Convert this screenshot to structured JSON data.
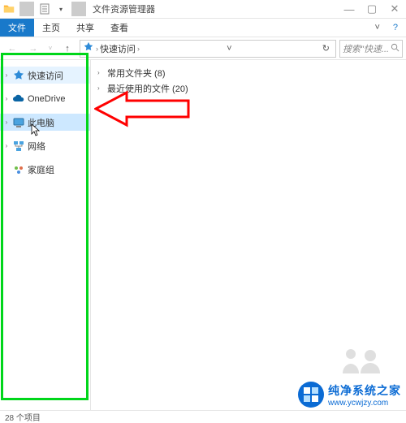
{
  "window": {
    "title": "文件资源管理器",
    "controls": {
      "min": "—",
      "max": "▢",
      "close": "✕"
    }
  },
  "ribbon": {
    "file": "文件",
    "home": "主页",
    "share": "共享",
    "view": "查看",
    "expand_icon": "˅",
    "help_icon": "?"
  },
  "address": {
    "back": "←",
    "forward": "→",
    "recent_drop": "˅",
    "up": "↑",
    "crumb_sep": "›",
    "location": "快速访问",
    "location_sep": "›",
    "refresh": "↻",
    "go_drop": "˅",
    "search_placeholder": "搜索\"快速...",
    "search_icon": "🔍"
  },
  "nav": {
    "items": [
      {
        "twisty": "›",
        "label": "快速访问",
        "icon": "star",
        "cls": "quick"
      },
      {
        "twisty": "›",
        "label": "OneDrive",
        "icon": "cloud",
        "cls": ""
      },
      {
        "twisty": "›",
        "label": "此电脑",
        "icon": "pc",
        "cls": "selected"
      },
      {
        "twisty": "›",
        "label": "网络",
        "icon": "net",
        "cls": ""
      },
      {
        "twisty": "",
        "label": "家庭组",
        "icon": "home",
        "cls": ""
      }
    ]
  },
  "content": {
    "rows": [
      {
        "twisty": "›",
        "label": "常用文件夹 (8)"
      },
      {
        "twisty": "›",
        "label": "最近使用的文件 (20)"
      }
    ]
  },
  "status": {
    "text": "28 个项目"
  },
  "watermark": {
    "line1": "纯净系统之家",
    "line2": "www.ycwjzy.com"
  }
}
